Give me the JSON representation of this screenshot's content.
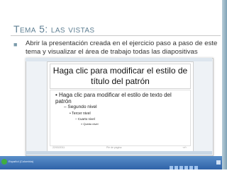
{
  "slide_outer": {
    "title": "Tema 5: las vistas",
    "bullet_text": "Abrir la presentación creada en el ejercicio  paso a paso de este tema y visualizar el área de trabajo todas las diapositivas"
  },
  "embedded_screenshot": {
    "slide_title": "Haga clic para modificar el estilo de título del patrón",
    "body_level1": "Haga clic para modificar el estilo de texto del patrón",
    "body_level2": "Segundo nivel",
    "body_level3": "Tercer nivel",
    "body_level4": "Cuarto nivel",
    "body_level5": "Quinto nivel",
    "footer_date": "22/03/2011",
    "footer_center": "Pie de página",
    "footer_number": "‹nº›",
    "taskbar_label": "Español (Colombia)"
  },
  "colors": {
    "title": "#5f7f93",
    "accent_band": "#7fa2b6",
    "taskbar": "#2f62a8"
  }
}
